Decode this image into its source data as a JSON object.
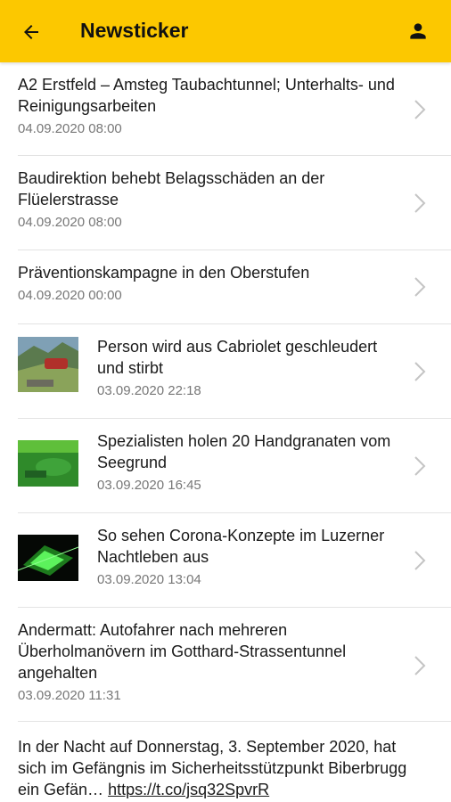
{
  "header": {
    "title": "Newsticker",
    "back_icon": "arrow-left-icon",
    "profile_icon": "person-icon",
    "bg_color": "#fcc800"
  },
  "items": [
    {
      "headline": "A2 Erstfeld – Amsteg Taubachtunnel; Unterhalts- und Reinigungsarbeiten",
      "date": "04.09.2020 08:00"
    },
    {
      "headline": "Baudirektion behebt Belagsschäden an der Flüelerstrasse",
      "date": "04.09.2020 08:00"
    },
    {
      "headline": "Präventionskampagne in den Oberstufen",
      "date": "04.09.2020 00:00"
    },
    {
      "headline": "Person wird aus Cabriolet geschleudert und stirbt",
      "date": "03.09.2020 22:18",
      "thumb": "car-accident-photo"
    },
    {
      "headline": "Spezialisten holen 20 Handgranaten vom Seegrund",
      "date": "03.09.2020 16:45",
      "thumb": "underwater-photo"
    },
    {
      "headline": "So sehen Corona-Konzepte im Luzerner Nachtleben aus",
      "date": "03.09.2020 13:04",
      "thumb": "nightclub-laser-photo"
    },
    {
      "headline": "Andermatt: Autofahrer nach mehreren Überholmanövern im Gotthard-Strassentunnel angehalten",
      "date": "03.09.2020 11:31"
    },
    {
      "headline": "In der Nacht auf Donnerstag, 3. September 2020, hat sich im Gefängnis im Sicherheitsstützpunkt Biberbrugg ein Gefän… ",
      "link": "https://t.co/jsq32SpvrR"
    }
  ]
}
